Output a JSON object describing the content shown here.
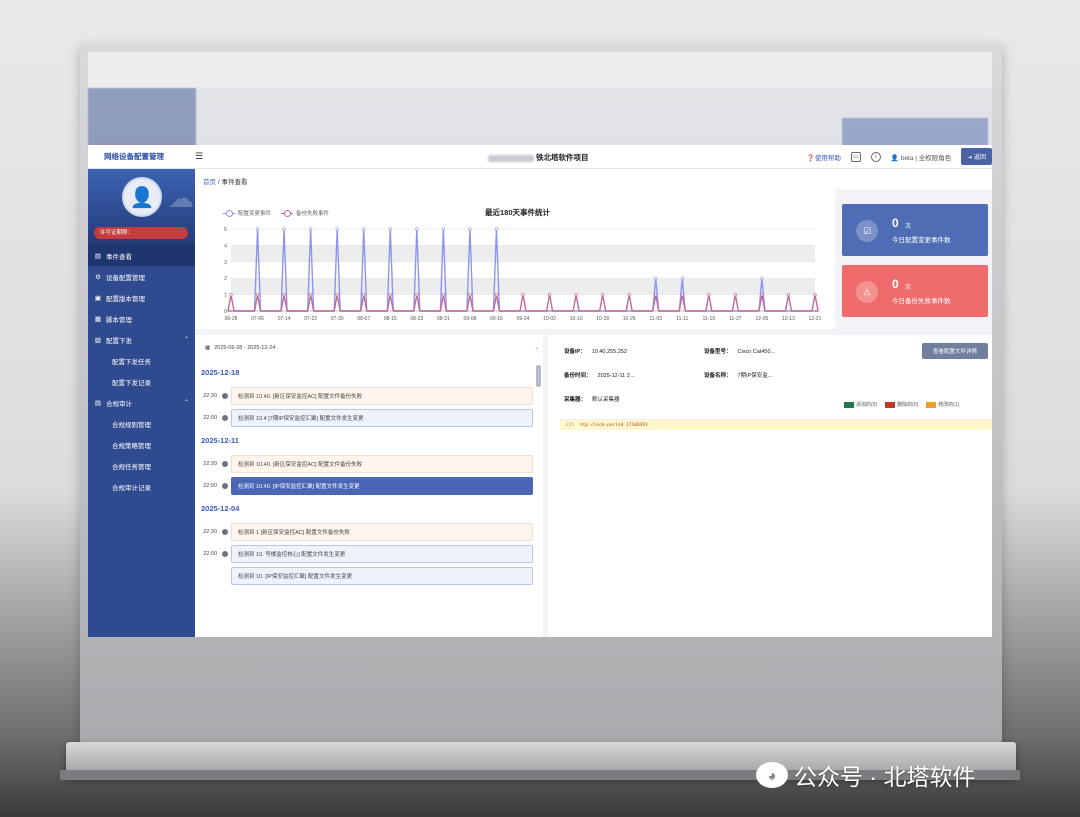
{
  "app": {
    "brand": "网络设备配置管理",
    "project": "铁北塔软件项目",
    "help": "使用帮助",
    "user": "beta | 全权限角色",
    "logout": "返回"
  },
  "sidebar": {
    "license": "许可证期限：",
    "items": [
      {
        "label": "事件查看",
        "icon": "file-icon"
      },
      {
        "label": "设备配置管理",
        "icon": "gear-icon"
      },
      {
        "label": "配置版本管理",
        "icon": "doc-icon"
      },
      {
        "label": "脚本管理",
        "icon": "script-icon"
      },
      {
        "label": "配置下发",
        "icon": "send-icon"
      },
      {
        "label": "配置下发任务"
      },
      {
        "label": "配置下发记录"
      },
      {
        "label": "合规审计",
        "icon": "audit-icon"
      },
      {
        "label": "合规规则管理"
      },
      {
        "label": "合规策略管理"
      },
      {
        "label": "合规任务管理"
      },
      {
        "label": "合规审计记录"
      }
    ]
  },
  "breadcrumb": {
    "home": "首页",
    "current": "事件查看"
  },
  "chart": {
    "title": "最近180天事件统计",
    "legend": [
      "配置变更事件",
      "备份失败事件"
    ]
  },
  "chart_data": {
    "type": "line",
    "title": "最近180天事件统计",
    "x": [
      "06-28",
      "07-06",
      "07-14",
      "07-22",
      "07-30",
      "08-07",
      "08-15",
      "08-23",
      "08-31",
      "09-08",
      "09-16",
      "09-24",
      "10-02",
      "10-10",
      "10-18",
      "10-26",
      "11-03",
      "11-11",
      "11-19",
      "11-27",
      "12-05",
      "12-13",
      "12-21"
    ],
    "ylim": [
      0,
      5
    ],
    "yticks": [
      0,
      1,
      2,
      3,
      4,
      5
    ],
    "series": [
      {
        "name": "配置变更事件",
        "color": "#8f96e8",
        "values": [
          0,
          5,
          5,
          5,
          5,
          5,
          5,
          5,
          5,
          5,
          5,
          0,
          0,
          0,
          0,
          0,
          2,
          2,
          0,
          0,
          2,
          0,
          0
        ]
      },
      {
        "name": "备份失败事件",
        "color": "#c06a95",
        "values": [
          1,
          1,
          1,
          1,
          1,
          1,
          1,
          1,
          1,
          1,
          1,
          1,
          1,
          1,
          1,
          1,
          1,
          1,
          1,
          1,
          1,
          1,
          1
        ]
      }
    ]
  },
  "stats": [
    {
      "value": "0",
      "unit": "次",
      "label": "今日配置变更事件数",
      "color": "#4f6db5"
    },
    {
      "value": "0",
      "unit": "次",
      "label": "今日备份失败事件数",
      "color": "#f06c6c"
    }
  ],
  "filter": {
    "date_range": "2025-06-28 - 2025-12-24"
  },
  "timeline": [
    {
      "date": "2025-12-18",
      "events": [
        {
          "time": "22:20",
          "text": "检测到 10.40.   [新区保安监控AC] 配置文件备份失败",
          "kind": "fail"
        },
        {
          "time": "22:00",
          "text": "检测到 10.4   [7期IP保安监控汇聚] 配置文件发生变更",
          "kind": "change"
        }
      ]
    },
    {
      "date": "2025-12-11",
      "events": [
        {
          "time": "22:20",
          "text": "检测到 10.40.   [新区保安监控AC] 配置文件备份失败",
          "kind": "fail"
        },
        {
          "time": "22:00",
          "text": "检测到 10.40.   [IP保安监控汇聚] 配置文件发生变更",
          "kind": "sel"
        }
      ]
    },
    {
      "date": "2025-12-04",
      "events": [
        {
          "time": "22:20",
          "text": "检测到 1   [新区保安监控AC] 配置文件备份失败",
          "kind": "fail"
        },
        {
          "time": "22:00",
          "text": "检测到 10.   号楼监控核心] 配置文件发生变更",
          "kind": "change"
        },
        {
          "time": "",
          "text": "检测到 10.   [IP保安监控汇聚] 配置文件发生变更",
          "kind": "change"
        }
      ]
    }
  ],
  "detail": {
    "ip_label": "设备IP：",
    "ip": "10.40.255.252",
    "model_label": "设备型号：",
    "model": "Cisco Cat450...",
    "backup_label": "备份时间：",
    "backup": "2025-12-11 2...",
    "name_label": "设备名称：",
    "name": "7期IP保安监...",
    "collector_label": "采集器：",
    "collector": "默认采集器",
    "button": "查看配置文件详情",
    "diff_legend": [
      {
        "label": "添加的(0)",
        "color": "#1f7a4c"
      },
      {
        "label": "删除的(0)",
        "color": "#c0392b"
      },
      {
        "label": "修改的(1)",
        "color": "#f0a020"
      }
    ],
    "code_line_no": "215",
    "code": "ntp clock-period 17180391"
  },
  "watermark": "公众号 · 北塔软件"
}
